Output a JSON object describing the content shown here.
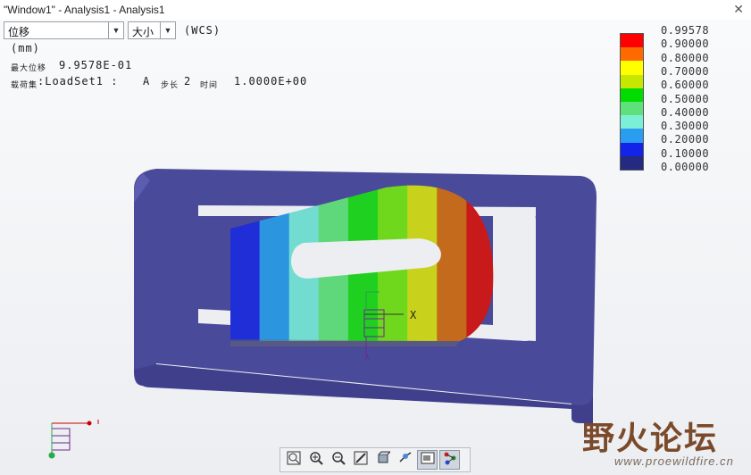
{
  "window": {
    "title": "\"Window1\" - Analysis1 - Analysis1",
    "close_symbol": "✕"
  },
  "controls": {
    "quantity_select": {
      "value": "位移"
    },
    "component_select": {
      "value": "大小"
    },
    "coord_system": "(WCS)"
  },
  "result_info": {
    "units": "(mm)",
    "max_label": "最大位移",
    "max_value": "9.9578E-01",
    "loadset_label": "载荷集",
    "loadset_value": ":LoadSet1 :",
    "loadset_case": "A",
    "step_label": "步长",
    "step_value": "2",
    "time_label": "时间",
    "time_value": "1.0000E+00"
  },
  "legend": {
    "colors": [
      "#ff0000",
      "#ff6a00",
      "#ffff00",
      "#c6e800",
      "#00dc00",
      "#5ee07a",
      "#7cf0d6",
      "#2a9df0",
      "#1423e8",
      "#232a80"
    ],
    "labels": [
      "0.99578",
      "0.90000",
      "0.80000",
      "0.70000",
      "0.60000",
      "0.50000",
      "0.40000",
      "0.30000",
      "0.20000",
      "0.10000",
      "0.00000"
    ]
  },
  "model": {
    "frame_color": "#4a4a9a",
    "band_colors": [
      "#1f2ed6",
      "#2b95e0",
      "#72dcd0",
      "#5ed87a",
      "#20d020",
      "#6fd81c",
      "#c8d21c",
      "#c46a1c",
      "#c81a1a"
    ]
  },
  "triad": {
    "x_label": "X",
    "y_label": "Y"
  },
  "toolbar": [
    {
      "name": "zoom-fit",
      "active": false
    },
    {
      "name": "zoom-in",
      "active": false
    },
    {
      "name": "zoom-out",
      "active": false
    },
    {
      "name": "repaint",
      "active": false
    },
    {
      "name": "saved-views",
      "active": false
    },
    {
      "name": "spin-center",
      "active": false
    },
    {
      "name": "display-style",
      "active": true
    },
    {
      "name": "datum-display",
      "active": true
    }
  ],
  "watermark": {
    "title": "野火论坛",
    "url": "www.proewildfire.cn"
  }
}
